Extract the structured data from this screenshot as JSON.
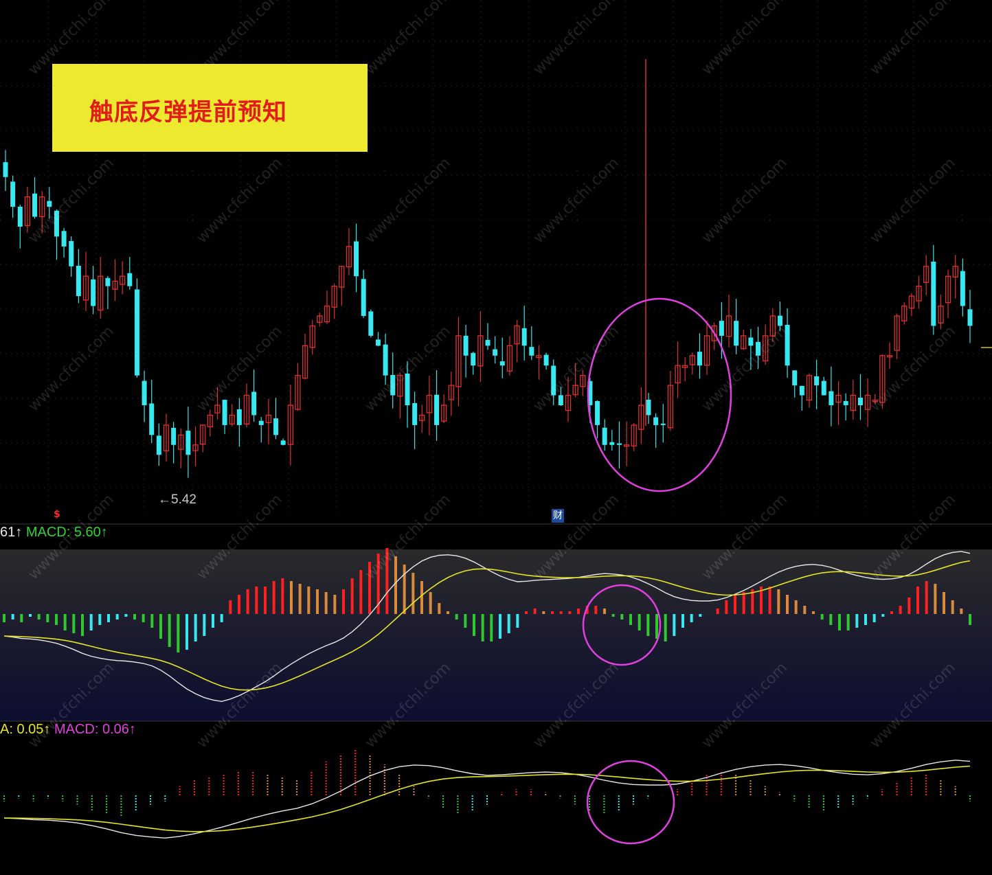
{
  "banner": {
    "text": "触底反弹提前预知",
    "bg": "#ece92f",
    "color": "#e21b1b"
  },
  "price_panel": {
    "low_label": "←5.42",
    "marker_s": "$",
    "marker_cai": "财"
  },
  "macd_panel_1": {
    "left_value": "61↑",
    "macd_label": "MACD: 5.60↑"
  },
  "macd_panel_2": {
    "left_value": "A: 0.05↑",
    "macd_label": "MACD: 0.06↑"
  },
  "watermark": "www.cfchi.com",
  "colors": {
    "up": "#e03030",
    "down": "#38e8f0",
    "dif": "#e8e8e8",
    "dea": "#e6e622",
    "circle": "#e040e0"
  },
  "chart_data": [
    {
      "type": "candlestick",
      "closes": [
        8.5,
        8.2,
        8.0,
        8.3,
        8.1,
        8.3,
        8.2,
        7.9,
        7.8,
        7.6,
        7.3,
        7.5,
        7.2,
        7.5,
        7.4,
        7.45,
        7.5,
        7.4,
        6.5,
        6.2,
        5.9,
        5.7,
        6.0,
        5.8,
        5.9,
        5.7,
        5.8,
        6.0,
        6.1,
        6.2,
        6.0,
        6.1,
        6.0,
        6.3,
        6.1,
        6.0,
        6.1,
        5.9,
        5.8,
        6.2,
        6.5,
        6.8,
        7.0,
        7.1,
        7.2,
        7.4,
        7.6,
        7.8,
        7.5,
        7.1,
        6.9,
        6.8,
        6.5,
        6.3,
        6.5,
        6.2,
        6.0,
        6.1,
        6.3,
        6.0,
        6.2,
        6.4,
        6.9,
        6.7,
        6.6,
        6.9,
        6.8,
        6.7,
        6.6,
        6.8,
        7.0,
        6.8,
        6.7,
        6.7,
        6.6,
        6.3,
        6.2,
        6.3,
        6.4,
        6.5,
        6.2,
        6.0,
        5.8,
        5.8,
        5.8,
        5.8,
        6.0,
        6.2,
        6.1,
        6.0,
        6.0,
        6.4,
        6.6,
        6.6,
        6.7,
        6.6,
        6.9,
        7.0,
        6.9,
        7.1,
        6.8,
        6.9,
        6.8,
        6.7,
        6.9,
        7.1,
        7.0,
        6.6,
        6.4,
        6.3,
        6.5,
        6.4,
        6.3,
        6.2,
        6.3,
        6.2,
        6.3,
        6.2,
        6.3,
        6.25,
        6.7,
        6.7,
        7.1,
        7.2,
        7.3,
        7.4,
        7.6,
        7.0,
        7.2,
        7.5,
        7.6,
        7.2,
        7.0
      ],
      "y_low_label": 5.42
    },
    {
      "type": "macd",
      "name": "MACD",
      "hist": [
        -0.3,
        -0.2,
        -0.3,
        -0.1,
        -0.2,
        -0.3,
        -0.4,
        -0.6,
        -0.7,
        -0.8,
        -0.6,
        -0.4,
        -0.3,
        -0.2,
        -0.1,
        -0.2,
        -0.3,
        -0.5,
        -0.9,
        -1.2,
        -1.4,
        -1.3,
        -1.0,
        -0.8,
        -0.5,
        -0.3,
        0.5,
        0.7,
        0.9,
        1.0,
        1.0,
        1.2,
        1.3,
        1.2,
        1.1,
        1.0,
        0.9,
        0.8,
        0.7,
        0.9,
        1.3,
        1.6,
        1.9,
        2.2,
        2.4,
        2.1,
        1.8,
        1.5,
        1.2,
        0.8,
        0.4,
        0.1,
        -0.2,
        -0.5,
        -0.8,
        -1.0,
        -1.0,
        -0.9,
        -0.7,
        -0.5,
        0.1,
        0.2,
        0.1,
        0.1,
        0.1,
        0.1,
        0.2,
        0.3,
        0.3,
        0.2,
        -0.1,
        -0.2,
        -0.4,
        -0.6,
        -0.8,
        -0.9,
        -1.0,
        -0.8,
        -0.5,
        -0.3,
        -0.1,
        0.0,
        0.2,
        0.5,
        0.7,
        0.8,
        0.9,
        1.0,
        1.0,
        0.9,
        0.7,
        0.5,
        0.3,
        0.1,
        -0.2,
        -0.4,
        -0.6,
        -0.6,
        -0.5,
        -0.4,
        -0.3,
        -0.1,
        0.1,
        0.3,
        0.6,
        1.0,
        1.2,
        1.1,
        0.8,
        0.5,
        0.2,
        -0.4
      ]
    },
    {
      "type": "macd",
      "name": "MACD",
      "hist": [
        -0.2,
        -0.1,
        -0.2,
        -0.1,
        -0.2,
        -0.3,
        -0.5,
        -0.6,
        -0.7,
        -0.5,
        -0.3,
        -0.2,
        0.3,
        0.5,
        0.6,
        0.7,
        0.8,
        0.8,
        0.7,
        0.6,
        0.5,
        0.8,
        1.1,
        1.3,
        1.5,
        1.3,
        1.0,
        0.7,
        0.3,
        -0.1,
        -0.4,
        -0.6,
        -0.5,
        -0.3,
        0.1,
        0.2,
        0.2,
        0.1,
        -0.1,
        -0.3,
        -0.5,
        -0.6,
        -0.5,
        -0.3,
        -0.1,
        0.0,
        0.2,
        0.5,
        0.7,
        0.8,
        0.7,
        0.5,
        0.3,
        0.1,
        -0.2,
        -0.4,
        -0.5,
        -0.4,
        -0.3,
        -0.1,
        0.2,
        0.4,
        0.6,
        0.7,
        0.5,
        0.3,
        -0.2
      ]
    }
  ]
}
